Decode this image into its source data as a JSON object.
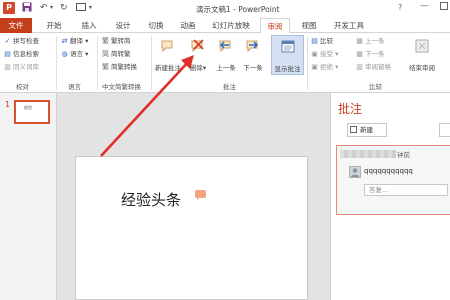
{
  "titlebar": {
    "app_letter": "P",
    "save_icon": "save-icon",
    "undo_icon": "undo-icon",
    "redo_icon": "redo-icon",
    "title": "演示文稿1 - PowerPoint",
    "help": "?",
    "minimize": "—"
  },
  "tabs": [
    "文件",
    "开始",
    "插入",
    "设计",
    "切换",
    "动画",
    "幻灯片放映",
    "审阅",
    "视图",
    "开发工具"
  ],
  "active_tab": "审阅",
  "ribbon": {
    "proofing": {
      "spell": "拼写检查",
      "research": "信息检索",
      "thesaurus": "同义词库",
      "label": "校对"
    },
    "language": {
      "translate": "翻译",
      "language": "语言",
      "label": "语言"
    },
    "chinese": {
      "to_traditional": "繁转简",
      "to_simplified": "简转繁",
      "convert": "简繁转换",
      "label": "中文简繁转换"
    },
    "comments": {
      "new": "新建批注",
      "delete": "删除",
      "prev": "上一条",
      "next": "下一条",
      "show": "显示批注",
      "label": "批注"
    },
    "compare": {
      "compare": "比较",
      "accept": "接受",
      "reject": "拒绝",
      "prev": "上一条",
      "next": "下一条",
      "pane": "审阅窗格",
      "end": "结束审阅",
      "label": "比较"
    }
  },
  "thumbnail": {
    "number": "1",
    "text": "经验"
  },
  "slide": {
    "text": "经验头条"
  },
  "comments_pane": {
    "title": "批注",
    "new_label": "新建",
    "comment": {
      "time": "钟前",
      "text": "qqqqqqqqqqq",
      "reply_placeholder": "答复..."
    }
  },
  "colors": {
    "accent": "#c43e1c",
    "arrow": "#e0302a",
    "comment_border": "#e38a76"
  }
}
